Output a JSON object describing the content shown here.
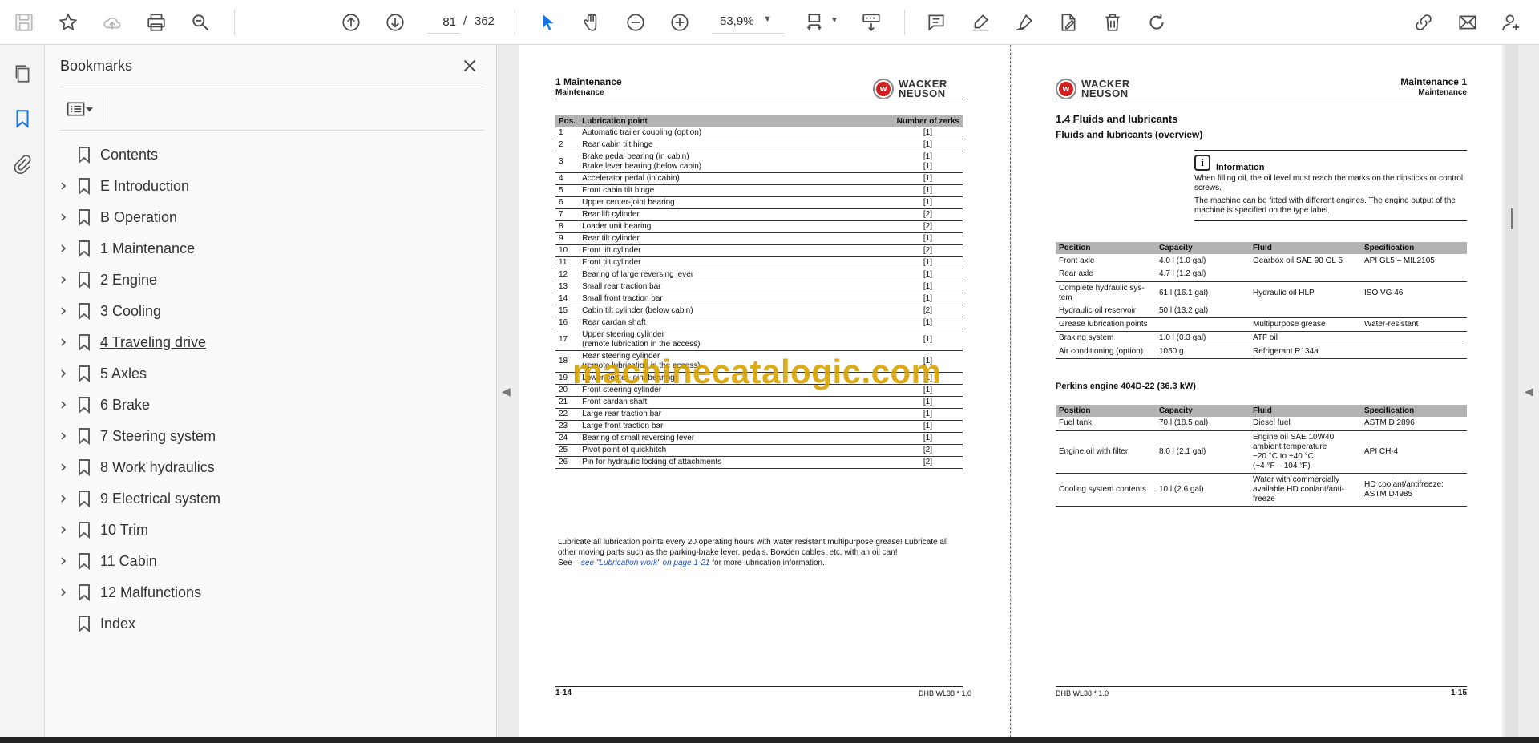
{
  "toolbar": {
    "page_current": "81",
    "page_separator": "/",
    "page_total": "362",
    "zoom": "53,9%"
  },
  "bookmarks": {
    "title": "Bookmarks",
    "items": [
      {
        "label": "Contents",
        "expandable": false
      },
      {
        "label": "E Introduction",
        "expandable": true
      },
      {
        "label": "B Operation",
        "expandable": true
      },
      {
        "label": "1 Maintenance",
        "expandable": true
      },
      {
        "label": "2 Engine",
        "expandable": true
      },
      {
        "label": "3 Cooling",
        "expandable": true
      },
      {
        "label": "4 Traveling drive",
        "expandable": true
      },
      {
        "label": "5 Axles",
        "expandable": true
      },
      {
        "label": "6 Brake",
        "expandable": true
      },
      {
        "label": "7 Steering system",
        "expandable": true
      },
      {
        "label": "8 Work hydraulics",
        "expandable": true
      },
      {
        "label": "9 Electrical system",
        "expandable": true
      },
      {
        "label": "10 Trim",
        "expandable": true
      },
      {
        "label": "11 Cabin",
        "expandable": true
      },
      {
        "label": "12 Malfunctions",
        "expandable": true
      },
      {
        "label": "Index",
        "expandable": false
      }
    ]
  },
  "left_page": {
    "chapter": "1   Maintenance",
    "chapter_sub": "Maintenance",
    "logo_line1": "WACKER",
    "logo_line2": "NEUSON",
    "table_headers": [
      "Pos.",
      "Lubrication point",
      "Number of zerks"
    ],
    "rows": [
      [
        "1",
        "Automatic trailer coupling (option)",
        "[1]"
      ],
      [
        "2",
        "Rear cabin tilt hinge",
        "[1]"
      ],
      [
        "3",
        "Brake pedal bearing (in cabin)\nBrake lever bearing (below cabin)",
        "[1]\n[1]"
      ],
      [
        "4",
        "Accelerator pedal (in cabin)",
        "[1]"
      ],
      [
        "5",
        "Front cabin tilt hinge",
        "[1]"
      ],
      [
        "6",
        "Upper center-joint bearing",
        "[1]"
      ],
      [
        "7",
        "Rear lift cylinder",
        "[2]"
      ],
      [
        "8",
        "Loader unit bearing",
        "[2]"
      ],
      [
        "9",
        "Rear tilt cylinder",
        "[1]"
      ],
      [
        "10",
        "Front lift cylinder",
        "[2]"
      ],
      [
        "11",
        "Front tilt cylinder",
        "[1]"
      ],
      [
        "12",
        "Bearing of large reversing lever",
        "[1]"
      ],
      [
        "13",
        "Small rear traction bar",
        "[1]"
      ],
      [
        "14",
        "Small front traction bar",
        "[1]"
      ],
      [
        "15",
        "Cabin tilt cylinder (below cabin)",
        "[2]"
      ],
      [
        "16",
        "Rear cardan shaft",
        "[1]"
      ],
      [
        "17",
        "Upper steering cylinder\n(remote lubrication in the access)",
        "[1]"
      ],
      [
        "18",
        "Rear steering cylinder\n(remote lubrication in the access)",
        "[1]"
      ],
      [
        "19",
        "Lower center-joint bearing",
        "[1]"
      ],
      [
        "20",
        "Front steering cylinder",
        "[1]"
      ],
      [
        "21",
        "Front cardan shaft",
        "[1]"
      ],
      [
        "22",
        "Large rear traction bar",
        "[1]"
      ],
      [
        "23",
        "Large front traction bar",
        "[1]"
      ],
      [
        "24",
        "Bearing of small reversing lever",
        "[1]"
      ],
      [
        "25",
        "Pivot point of quickhitch",
        "[2]"
      ],
      [
        "26",
        "Pin for hydraulic locking of attachments",
        "[2]"
      ]
    ],
    "note_line1": "Lubricate all lubrication points every 20 operating hours with water resistant multipurpose grease! Lubricate all",
    "note_line2": "other moving parts such as the parking-brake lever, pedals, Bowden cables, etc. with an oil can!",
    "note_see": "See – ",
    "note_link": "see \"Lubrication work\" on page 1-21",
    "note_tail": " for more lubrication information.",
    "footer_page": "1-14",
    "footer_doc": "DHB WL38 * 1.0"
  },
  "right_page": {
    "chapter": "Maintenance  1",
    "chapter_sub": "Maintenance",
    "logo_line1": "WACKER",
    "logo_line2": "NEUSON",
    "section_title": "1.4    Fluids and lubricants",
    "section_sub": "Fluids and lubricants (overview)",
    "info_title": "Information",
    "info_p1": "When filling oil, the oil level must reach the marks on the dipsticks or control screws.",
    "info_p2": "The machine can be fitted with different engines. The engine output of the machine is specified on the type label.",
    "table1_headers": [
      "Position",
      "Capacity",
      "Fluid",
      "Specification"
    ],
    "table1_rows": [
      [
        "Front axle",
        "4.0 l (1.0 gal)",
        "Gearbox oil SAE 90 GL 5",
        "API GL5 – MIL2105"
      ],
      [
        "Rear axle",
        "4.7 l (1.2 gal)",
        "",
        ""
      ],
      [
        "Complete hydraulic sys-\ntem",
        "61 l (16.1 gal)",
        "Hydraulic oil HLP",
        "ISO VG 46"
      ],
      [
        "Hydraulic oil reservoir",
        "50 l (13.2 gal)",
        "",
        ""
      ],
      [
        "Grease lubrication points",
        "",
        "Multipurpose grease",
        "Water-resistant"
      ],
      [
        "Braking system",
        "1.0 l (0.3 gal)",
        "ATF oil",
        ""
      ],
      [
        "Air conditioning (option)",
        "1050 g",
        "Refrigerant R134a",
        ""
      ]
    ],
    "engine_title": "Perkins engine 404D-22 (36.3 kW)",
    "table2_headers": [
      "Position",
      "Capacity",
      "Fluid",
      "Specification"
    ],
    "table2_rows": [
      [
        "Fuel tank",
        "70 l (18.5 gal)",
        "Diesel fuel",
        "ASTM D 2896"
      ],
      [
        "Engine oil with filter",
        "8.0 l (2.1 gal)",
        "Engine oil SAE 10W40\nambient temperature\n−20 °C to +40 °C\n(−4 °F – 104 °F)",
        "API CH-4"
      ],
      [
        "Cooling system contents",
        "10 l (2.6 gal)",
        "Water with commercially\navailable HD coolant/anti-\nfreeze",
        "HD coolant/antifreeze:\nASTM D4985"
      ]
    ],
    "footer_page": "1-15",
    "footer_doc": "DHB WL38 * 1.0"
  },
  "watermark": "machinecatalogic.com",
  "colors": {
    "accent": "#1473e6",
    "watermark": "#d9a300",
    "table_header": "#b3b3b3",
    "logo_red": "#d21f1f"
  },
  "icons": {
    "toolbar": [
      "save-icon",
      "star-icon",
      "cloud-upload-icon",
      "print-icon",
      "zoom-search-icon",
      "prev-page-icon",
      "next-page-icon",
      "select-cursor-icon",
      "hand-tool-icon",
      "zoom-out-icon",
      "zoom-in-icon",
      "fit-page-icon",
      "scroll-mode-icon",
      "comment-icon",
      "highlight-icon",
      "sign-icon",
      "edit-pdf-icon",
      "delete-icon",
      "rotate-icon",
      "share-link-icon",
      "mail-icon",
      "add-user-icon"
    ],
    "rail": [
      "pages-icon",
      "bookmark-icon",
      "attachment-icon"
    ]
  }
}
